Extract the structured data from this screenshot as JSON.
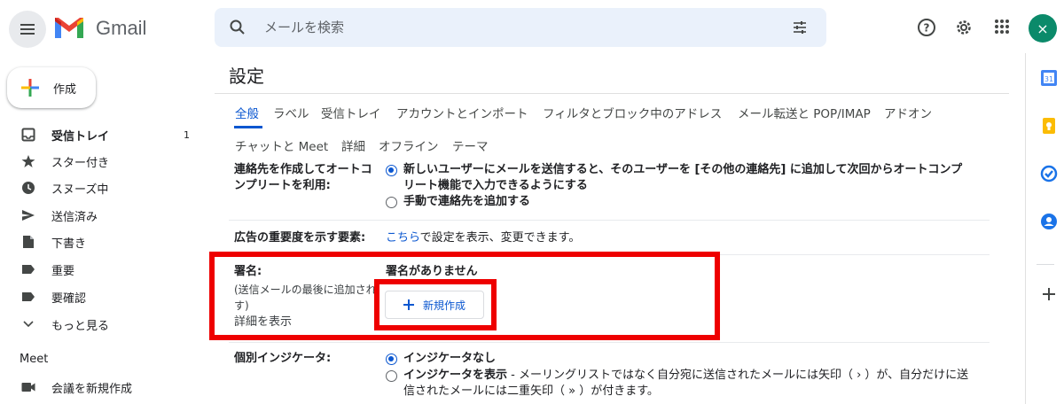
{
  "app": {
    "name": "Gmail"
  },
  "search": {
    "placeholder": "メールを検索"
  },
  "compose": {
    "label": "作成"
  },
  "nav": {
    "items": [
      {
        "label": "受信トレイ",
        "count": "1",
        "icon": "inbox-icon",
        "bold": true
      },
      {
        "label": "スター付き",
        "icon": "star-icon"
      },
      {
        "label": "スヌーズ中",
        "icon": "clock-icon"
      },
      {
        "label": "送信済み",
        "icon": "send-icon"
      },
      {
        "label": "下書き",
        "icon": "draft-icon"
      },
      {
        "label": "重要",
        "icon": "label-important-icon"
      },
      {
        "label": "要確認",
        "icon": "label-icon"
      },
      {
        "label": "もっと見る",
        "icon": "chevron-down-icon"
      }
    ],
    "meet_header": "Meet",
    "meet_item": "会議を新規作成"
  },
  "settings": {
    "title": "設定",
    "tabs_row1": [
      "全般",
      "ラベル",
      "受信トレイ",
      "アカウントとインポート",
      "フィルタとブロック中のアドレス",
      "メール転送と POP/IMAP",
      "アドオン"
    ],
    "tabs_row2": [
      "チャットと Meet",
      "詳細",
      "オフライン",
      "テーマ"
    ],
    "autocomplete": {
      "label_line1": "連絡先を作成してオートコ",
      "label_line2": "ンプリートを利用:",
      "option1_line1": "新しいユーザーにメールを送信すると、そのユーザーを [その他の連絡先] に追加して次回からオートコンプ",
      "option1_line2": "リート機能で入力できるようにする",
      "option2": "手動で連絡先を追加する"
    },
    "ads": {
      "label": "広告の重要度を示す要素:",
      "link": "こちら",
      "text": "で設定を表示、変更できます。"
    },
    "signature": {
      "label": "署名:",
      "sub_line1": "(送信メールの最後に追加され",
      "sub_line2": "す)",
      "details_link": "詳細を表示",
      "none_text": "署名がありません",
      "new_button": "新規作成"
    },
    "indicators": {
      "label": "個別インジケータ:",
      "option1": "インジケータなし",
      "option2_bold": "インジケータを表示",
      "option2_line1": " - メーリングリストではなく自分宛に送信されたメールには矢印（ › ）が、自分だけに送",
      "option2_line2": "信されたメールには二重矢印（ » ）が付きます。"
    }
  },
  "colors": {
    "accent": "#0b57d0",
    "highlight": "#ee0000",
    "avatar": "#0b8a6a"
  },
  "avatar_letter": "×"
}
